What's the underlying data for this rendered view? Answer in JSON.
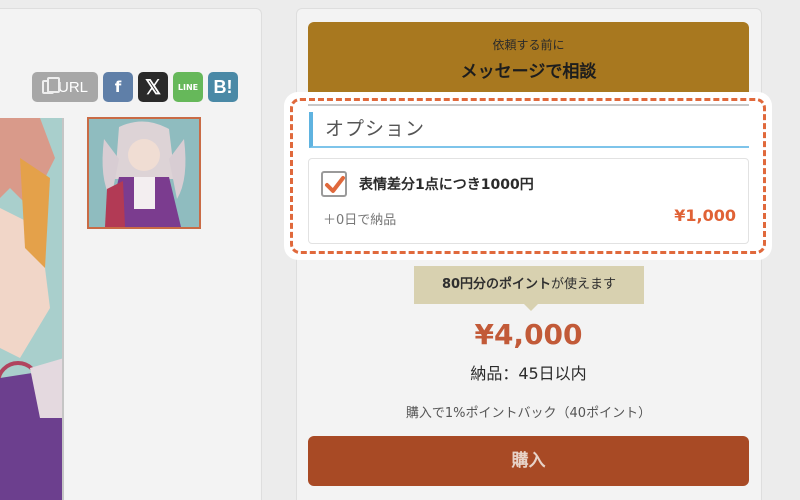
{
  "share": {
    "url_label": "URL",
    "facebook_glyph": "f",
    "x_glyph": "𝕏",
    "line_glyph": "LINE",
    "hatena_glyph": "B!"
  },
  "consult": {
    "sub_label": "依頼する前に",
    "main_label": "メッセージで相談"
  },
  "option": {
    "header": "オプション",
    "item": {
      "checked": true,
      "title": "表情差分1点につき1000円",
      "delivery_extra": "＋0日で納品",
      "price": "¥1,000"
    }
  },
  "purchase": {
    "points_strong": "80円分のポイント",
    "points_rest": "が使えます",
    "price": "¥4,000",
    "delivery": "納品：45日以内",
    "pointback": "購入で1%ポイントバック（40ポイント）",
    "buy_label": "購入"
  },
  "colors": {
    "accent": "#e0693c",
    "option_header_bar": "#5fb3e0"
  }
}
